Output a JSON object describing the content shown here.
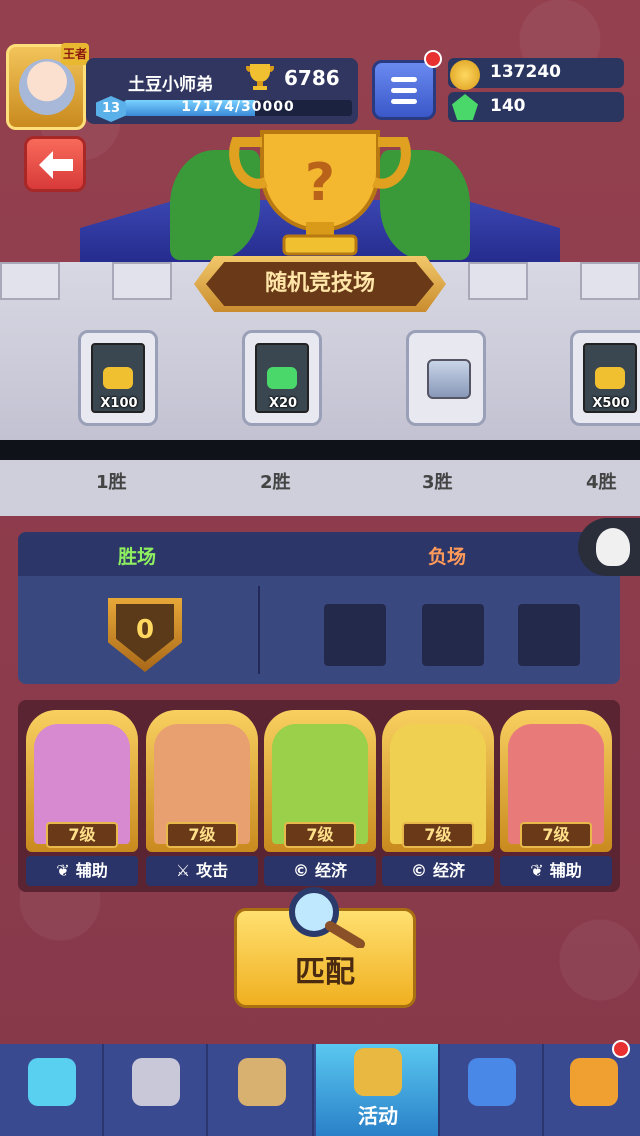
{
  "player": {
    "avatar_tag": "王者",
    "name": "土豆小师弟",
    "trophies": "6786",
    "level": "13",
    "xp_text": "17174/30000",
    "xp_progress": 0.5725
  },
  "resources": {
    "coins": "137240",
    "gems": "140"
  },
  "mode": {
    "title": "随机竞技场"
  },
  "rewards": [
    {
      "label": "X100",
      "kind": "coins"
    },
    {
      "label": "X20",
      "kind": "gems"
    },
    {
      "label": "",
      "kind": "chest"
    },
    {
      "label": "X500",
      "kind": "coins"
    }
  ],
  "milestones": [
    "1胜",
    "2胜",
    "3胜",
    "4胜"
  ],
  "record": {
    "wins_title": "胜场",
    "losses_title": "负场",
    "wins": "0"
  },
  "heroes": [
    {
      "level": "7级",
      "role": "辅助",
      "role_icon": "sprout-icon",
      "color": "#d88ad0"
    },
    {
      "level": "7级",
      "role": "攻击",
      "role_icon": "sword-icon",
      "color": "#e8a070"
    },
    {
      "level": "7级",
      "role": "经济",
      "role_icon": "copyright-icon",
      "color": "#9ad04a"
    },
    {
      "level": "7级",
      "role": "经济",
      "role_icon": "copyright-icon",
      "color": "#f0d050"
    },
    {
      "level": "7级",
      "role": "辅助",
      "role_icon": "sprout-icon",
      "color": "#e87a7a"
    }
  ],
  "match_button": "匹配",
  "nav": [
    {
      "name": "chest-icon",
      "label": ""
    },
    {
      "name": "helmet-icon",
      "label": ""
    },
    {
      "name": "crossed-swords-icon",
      "label": ""
    },
    {
      "name": "crown-icon",
      "label": "活动",
      "active": true
    },
    {
      "name": "friends-icon",
      "label": ""
    },
    {
      "name": "compass-icon",
      "label": ""
    }
  ]
}
